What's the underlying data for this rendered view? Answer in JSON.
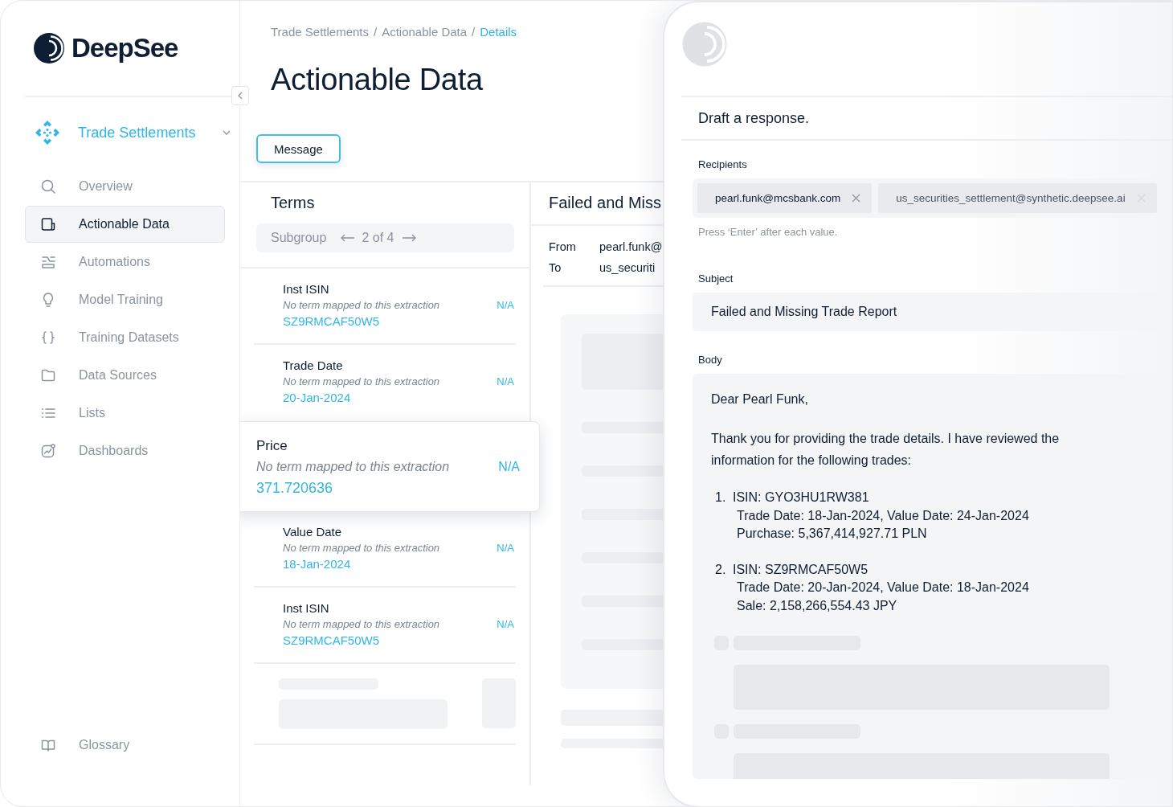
{
  "brand": {
    "name": "DeepSee"
  },
  "workspace": {
    "name": "Trade Settlements"
  },
  "nav": [
    {
      "label": "Overview",
      "kind": "search",
      "selected": false
    },
    {
      "label": "Actionable Data",
      "kind": "document",
      "selected": true
    },
    {
      "label": "Automations",
      "kind": "automation",
      "selected": false
    },
    {
      "label": "Model Training",
      "kind": "bulb",
      "selected": false
    },
    {
      "label": "Training Datasets",
      "kind": "braces",
      "selected": false
    },
    {
      "label": "Data Sources",
      "kind": "folder",
      "selected": false
    },
    {
      "label": "Lists",
      "kind": "list",
      "selected": false
    },
    {
      "label": "Dashboards",
      "kind": "chart",
      "selected": false
    }
  ],
  "footer_nav": [
    {
      "label": "Glossary",
      "kind": "book",
      "selected": false
    }
  ],
  "breadcrumb": [
    {
      "label": "Trade Settlements",
      "current": false
    },
    {
      "separator": "/",
      "label": "Actionable Data",
      "current": false
    },
    {
      "separator": "/",
      "label": "Details",
      "current": true
    }
  ],
  "title": "Actionable Data",
  "message_button": "Message",
  "terms": {
    "title": "Terms",
    "subgroup_label": "Subgroup",
    "pager": "2 of 4",
    "items": [
      {
        "name": "Inst ISIN",
        "note": "No term mapped to this extraction",
        "value": "SZ9RMCAF50W5",
        "status": "N/A",
        "highlighted": false
      },
      {
        "name": "Trade Date",
        "note": "No term mapped to this extraction",
        "value": "20-Jan-2024",
        "status": "N/A",
        "highlighted": false
      },
      {
        "name": "Price",
        "note": "No term mapped to this extraction",
        "value": "371.720636",
        "status": "N/A",
        "highlighted": true
      },
      {
        "name": "Value Date",
        "note": "No term mapped to this extraction",
        "value": "18-Jan-2024",
        "status": "N/A",
        "highlighted": false
      },
      {
        "name": "Inst ISIN",
        "note": "No term mapped to this extraction",
        "value": "SZ9RMCAF50W5",
        "status": "N/A",
        "highlighted": false
      }
    ]
  },
  "email_preview": {
    "title": "Failed and Miss",
    "fields": [
      {
        "label": "From",
        "value": "pearl.funk@"
      },
      {
        "label": "To",
        "value": "us_securiti"
      }
    ]
  },
  "draft": {
    "heading": "Draft a response.",
    "recipients_label": "Recipients",
    "recipients": [
      "pearl.funk@mcsbank.com",
      "us_securities_settlement@synthetic.deepsee.ai"
    ],
    "recipients_hint": "Press ‘Enter’ after each value.",
    "subject_label": "Subject",
    "subject": "Failed and Missing Trade Report",
    "body_label": "Body",
    "greeting": "Dear Pearl Funk,",
    "intro": "Thank you for providing the trade details. I have reviewed the information for the following trades:",
    "trades": [
      {
        "number": "1.",
        "isin": "ISIN: GYO3HU1RW381",
        "dates": "Trade Date: 18-Jan-2024, Value Date: 24-Jan-2024",
        "amount": "Purchase: 5,367,414,927.71 PLN"
      },
      {
        "number": "2.",
        "isin": "ISIN: SZ9RMCAF50W5",
        "dates": "Trade Date: 20-Jan-2024, Value Date: 18-Jan-2024",
        "amount": "Sale: 2,158,266,554.43 JPY"
      }
    ]
  }
}
